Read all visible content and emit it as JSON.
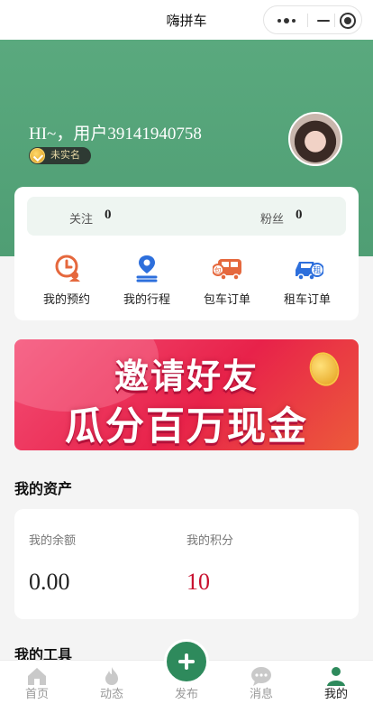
{
  "app": {
    "title": "嗨拼车"
  },
  "profile": {
    "greeting": "HI~，用户39141940758",
    "verify_badge": "未实名"
  },
  "stats": {
    "following_label": "关注",
    "following_count": "0",
    "fans_label": "粉丝",
    "fans_count": "0"
  },
  "shortcuts": [
    {
      "label": "我的预约",
      "icon": "clock-person-icon",
      "color": "#e5683d"
    },
    {
      "label": "我的行程",
      "icon": "route-pin-icon",
      "color": "#2d6fdc"
    },
    {
      "label": "包车订单",
      "icon": "charter-bus-icon",
      "color": "#e5683d"
    },
    {
      "label": "租车订单",
      "icon": "rental-car-icon",
      "color": "#2d6fdc"
    }
  ],
  "banner": {
    "line1": "邀请好友",
    "line2": "瓜分百万现金"
  },
  "assets": {
    "title": "我的资产",
    "balance_label": "我的余额",
    "balance_value": "0.00",
    "points_label": "我的积分",
    "points_value": "10"
  },
  "tools": {
    "title": "我的工具"
  },
  "tabbar": {
    "items": [
      {
        "label": "首页",
        "icon": "home-icon"
      },
      {
        "label": "动态",
        "icon": "flame-icon"
      },
      {
        "label": "发布",
        "icon": "plus-icon"
      },
      {
        "label": "消息",
        "icon": "chat-bubble-icon"
      },
      {
        "label": "我的",
        "icon": "person-icon"
      }
    ],
    "active_index": 4
  },
  "colors": {
    "brand_green": "#4f9e74",
    "accent_red": "#c8102e"
  }
}
